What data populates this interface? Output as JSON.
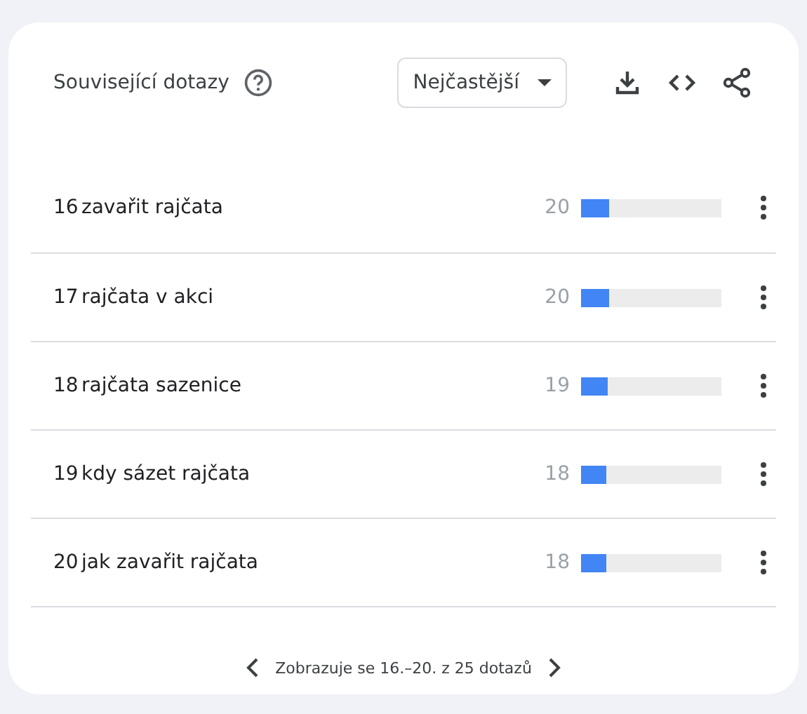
{
  "widget": {
    "title": "Související dotazy",
    "sort": {
      "value": "Nejčastější"
    }
  },
  "rows": [
    {
      "rank": "16",
      "query": "zavařit rajčata",
      "value": "20",
      "level": 0.2
    },
    {
      "rank": "17",
      "query": "rajčata v akci",
      "value": "20",
      "level": 0.2
    },
    {
      "rank": "18",
      "query": "rajčata sazenice",
      "value": "19",
      "level": 0.19
    },
    {
      "rank": "19",
      "query": "kdy sázet rajčata",
      "value": "18",
      "level": 0.18
    },
    {
      "rank": "20",
      "query": "jak zavařit rajčata",
      "value": "18",
      "level": 0.18
    }
  ],
  "pagination": {
    "text": "Zobrazuje se 16.–20. z 25 dotazů"
  }
}
